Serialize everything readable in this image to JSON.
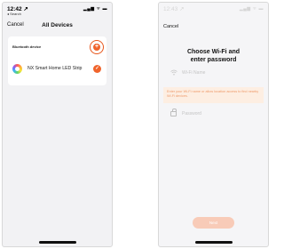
{
  "left": {
    "status": {
      "time": "12:42 ↗",
      "back_app": "◂ Search",
      "icons": "▂▄▆ ᯤ ▬"
    },
    "nav": {
      "cancel": "Cancel",
      "title": "All Devices"
    },
    "section": {
      "label": "Bluetooth device",
      "add_symbol": "+"
    },
    "devices": [
      {
        "name": "NX Smart Home LED Strip",
        "selected": true,
        "check_symbol": "✓"
      }
    ]
  },
  "right": {
    "status": {
      "time": "12:43 ↗",
      "icons": "▂▄▆ ᯤ ▬"
    },
    "nav": {
      "cancel": "Cancel"
    },
    "heading_line1": "Choose Wi-Fi and",
    "heading_line2": "enter password",
    "wifi": {
      "placeholder": "Wi-Fi Name",
      "icon": "wifi-icon"
    },
    "warning": "Enter your Wi-Fi name or allow location access to find nearby Wi-Fi devices.",
    "password": {
      "placeholder": "Password",
      "icon": "lock-icon"
    },
    "next": "Next"
  },
  "colors": {
    "accent": "#f0642c",
    "accent_light": "#f8cbb8",
    "warning_bg": "#fdeee2"
  }
}
